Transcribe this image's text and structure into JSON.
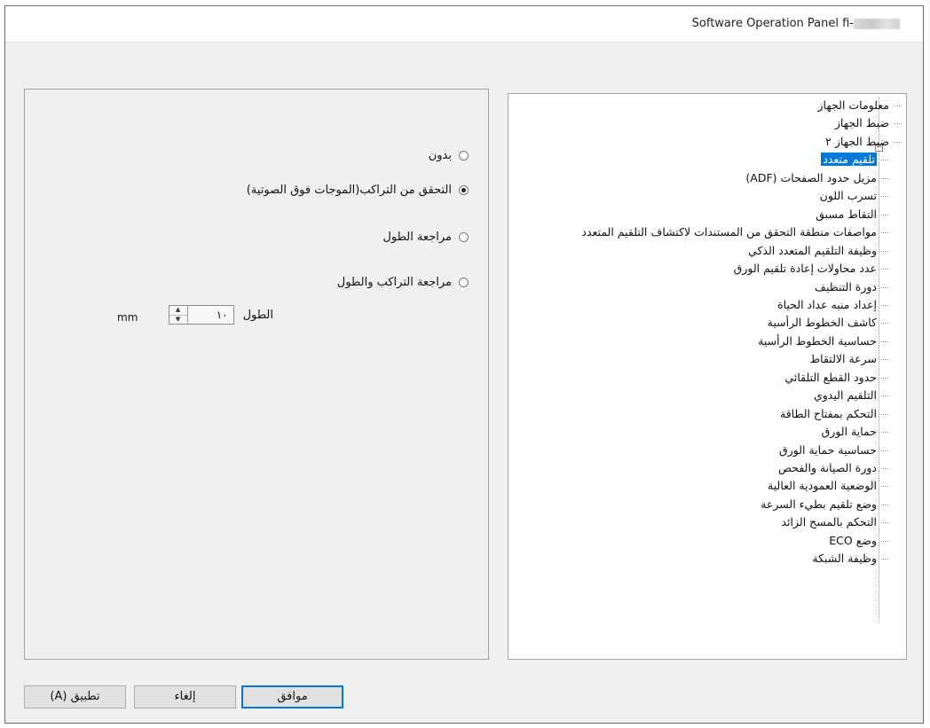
{
  "window": {
    "title": "Software Operation Panel fi-"
  },
  "options": {
    "radio_items": [
      {
        "label": "بدون",
        "checked": false
      },
      {
        "label": "التحقق من التراكب(الموجات فوق الصوتية)",
        "checked": true
      },
      {
        "label": "مراجعة الطول",
        "checked": false
      },
      {
        "label": "مراجعة  التراكب والطول",
        "checked": false
      }
    ],
    "length": {
      "label": "الطول",
      "value": "١٠",
      "unit": "mm"
    }
  },
  "tree": {
    "items": [
      {
        "label": "معلومات الجهاز",
        "level": "root"
      },
      {
        "label": "ضبط الجهاز",
        "level": "root"
      },
      {
        "label": "ضبط الجهاز ٢",
        "level": "root",
        "expanded": true
      },
      {
        "label": "تلقيم متعدد",
        "level": "child",
        "selected": true
      },
      {
        "label": "مزيل حدود الصفحات (ADF)",
        "level": "child"
      },
      {
        "label": "تسرب اللون",
        "level": "child"
      },
      {
        "label": "التقاط مسبق",
        "level": "child"
      },
      {
        "label": "مواصفات منطقة التحقق من المستندات لاكتشاف التلقيم المتعدد",
        "level": "child"
      },
      {
        "label": "وظيفة التلقيم المتعدد الذكي",
        "level": "child"
      },
      {
        "label": "عدد محاولات إعادة تلقيم الورق",
        "level": "child"
      },
      {
        "label": "دورة التنظيف",
        "level": "child"
      },
      {
        "label": "إعداد منبه عداد الحياة",
        "level": "child"
      },
      {
        "label": "كاشف الخطوط الرأسية",
        "level": "child"
      },
      {
        "label": "حساسية الخطوط الرأسية",
        "level": "child"
      },
      {
        "label": "سرعة الالتقاط",
        "level": "child"
      },
      {
        "label": "حدود القطع التلقائي",
        "level": "child"
      },
      {
        "label": "التلقيم اليدوي",
        "level": "child"
      },
      {
        "label": "التحكم بمفتاح الطاقة",
        "level": "child"
      },
      {
        "label": "حماية الورق",
        "level": "child"
      },
      {
        "label": "حساسية حماية الورق",
        "level": "child"
      },
      {
        "label": "دورة الصيانة والفحص",
        "level": "child"
      },
      {
        "label": "الوضعية العمودية العالية",
        "level": "child"
      },
      {
        "label": "وضع تلقيم بطيء السرعة",
        "level": "child"
      },
      {
        "label": "التحكم بالمسح الزائد",
        "level": "child"
      },
      {
        "label": "وضع ECO",
        "level": "child"
      },
      {
        "label": "وظيفة الشبكة",
        "level": "child"
      }
    ]
  },
  "buttons": {
    "ok": "موافق",
    "cancel": "إلغاء",
    "apply": "تطبيق (A)"
  }
}
